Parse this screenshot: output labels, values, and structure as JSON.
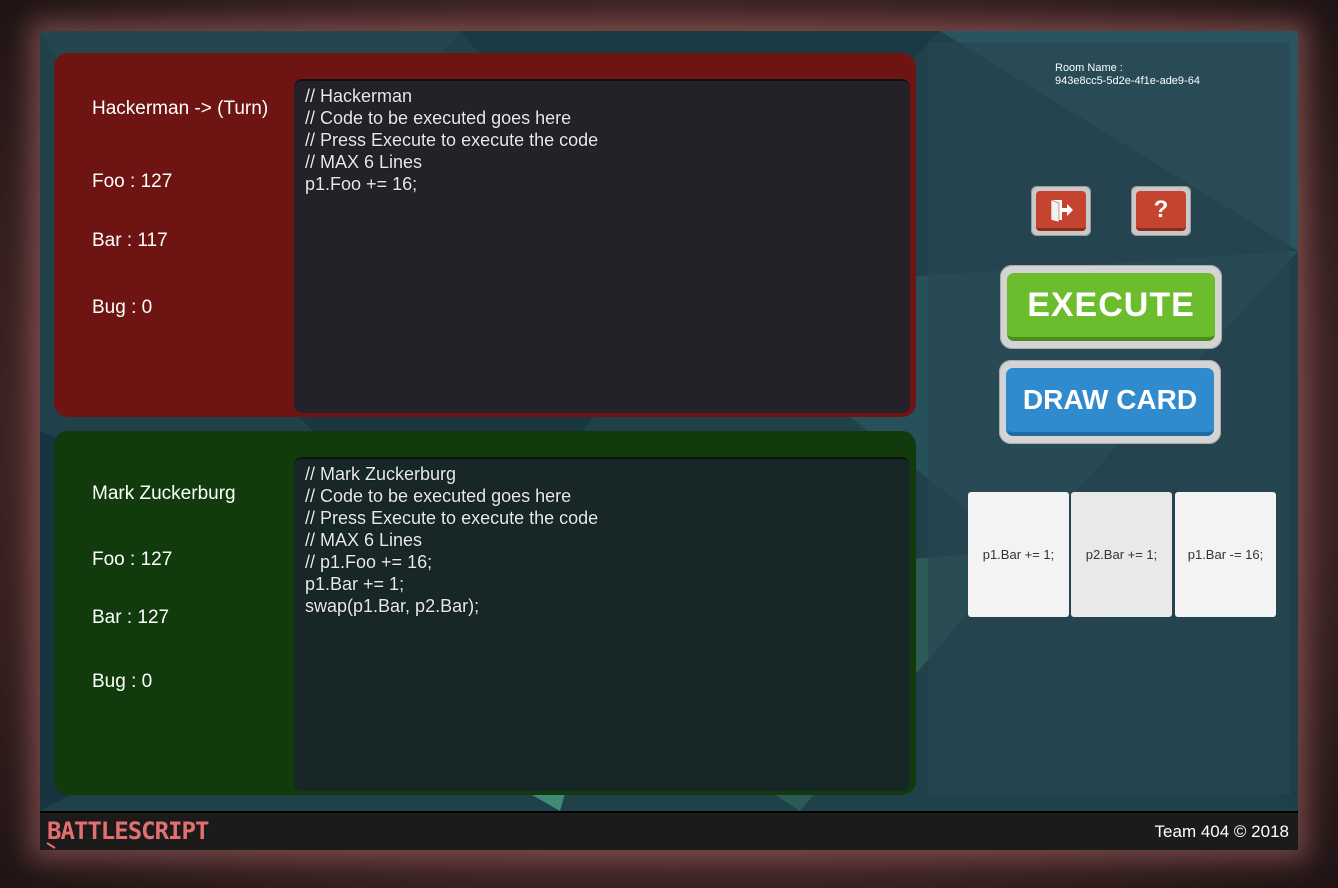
{
  "players": [
    {
      "name": "Hackerman -> (Turn)",
      "foo": "Foo : 127",
      "bar": "Bar : 117",
      "bug": "Bug : 0",
      "code": "// Hackerman\n// Code to be executed goes here\n// Press Execute to execute the code\n// MAX 6 Lines\np1.Foo += 16;",
      "color": "#6e1513"
    },
    {
      "name": "Mark Zuckerburg",
      "foo": "Foo : 127",
      "bar": "Bar : 127",
      "bug": "Bug : 0",
      "code": "// Mark Zuckerburg\n// Code to be executed goes here\n// Press Execute to execute the code\n// MAX 6 Lines\n// p1.Foo += 16;\np1.Bar += 1;\nswap(p1.Bar, p2.Bar);",
      "color": "#113a0d"
    }
  ],
  "room": {
    "label": "Room Name :",
    "id": "943e8cc5-5d2e-4f1e-ade9-64"
  },
  "buttons": {
    "exit_icon": "exit-door-icon",
    "help_label": "?",
    "execute_label": "EXECUTE",
    "draw_label": "DRAW CARD"
  },
  "cards": [
    "p1.Bar += 1;",
    "p2.Bar += 1;",
    "p1.Bar -= 16;"
  ],
  "footer": {
    "logo": "BATTLESCRIPT",
    "copyright": "Team 404 © 2018"
  },
  "colors": {
    "execute": "#6cbd2e",
    "draw": "#2f8bcd",
    "icon_button": "#c5442f",
    "logo": "#e36f6f"
  }
}
